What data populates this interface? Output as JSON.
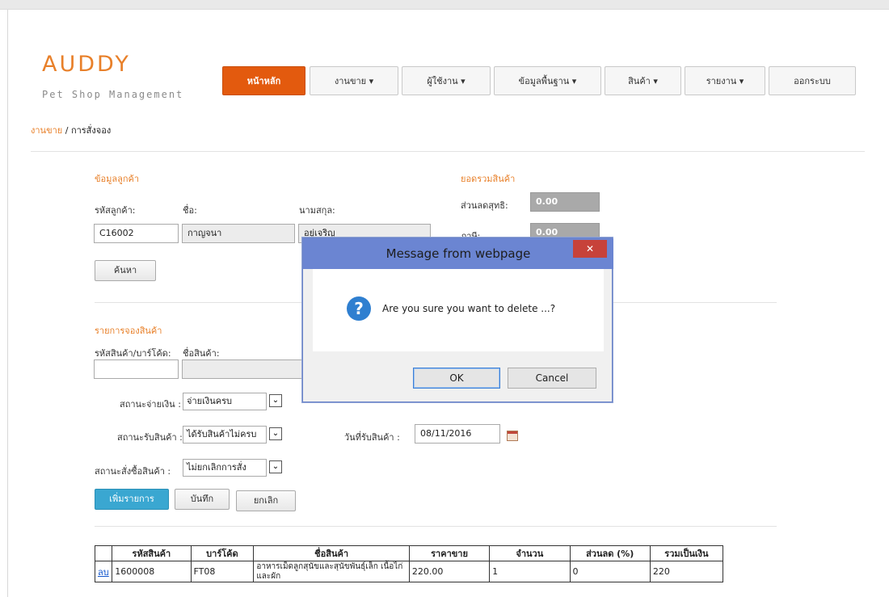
{
  "logo": {
    "title": "AUDDY",
    "tagline": "Pet Shop Management"
  },
  "nav": [
    {
      "label": "หน้าหลัก",
      "active": true
    },
    {
      "label": "งานขาย ▾"
    },
    {
      "label": "ผู้ใช้งาน ▾"
    },
    {
      "label": "ข้อมูลพื้นฐาน ▾"
    },
    {
      "label": "สินค้า ▾"
    },
    {
      "label": "รายงาน ▾"
    },
    {
      "label": "ออกระบบ"
    }
  ],
  "breadcrumb": {
    "parent": "งานขาย",
    "separator": "/",
    "current": "การสั่งจอง"
  },
  "customer": {
    "section_title": "ข้อมูลลูกค้า",
    "code_label": "รหัสลูกค้า:",
    "name_label": "ชื่อ:",
    "surname_label": "นามสกุล:",
    "code_value": "C16002",
    "name_value": "กาญจนา",
    "surname_value": "อยู่เจริญ",
    "search_button": "ค้นหา"
  },
  "summary": {
    "section_title": "ยอดรวมสินค้า",
    "discount_label": "ส่วนลดสุทธิ:",
    "discount_value": "0.00",
    "tax_label": "ภาษี:",
    "tax_value": "0.00"
  },
  "order": {
    "section_title": "รายการจองสินค้า",
    "code_label": "รหัสสินค้า/บาร์โค้ด:",
    "product_label": "ชื่อสินค้า:",
    "payment_label": "สถานะจ่ายเงิน :",
    "payment_value": "จ่ายเงินครบ",
    "receive_label": "สถานะรับสินค้า :",
    "receive_value": "ได้รับสินค้าไม่ครบ",
    "order_status_label": "สถานะสั่งซื้อสินค้า :",
    "order_status_value": "ไม่ยกเลิกการสั่ง",
    "receive_date_label": "วันที่รับสินค้า :",
    "receive_date_value": "08/11/2016",
    "add_button": "เพิ่มรายการ",
    "save_button": "บันทึก",
    "cancel_button": "ยกเลิก"
  },
  "table": {
    "headers": [
      "",
      "รหัสสินค้า",
      "บาร์โค้ด",
      "ชื่อสินค้า",
      "ราคาขาย",
      "จำนวน",
      "ส่วนลด (%)",
      "รวมเป็นเงิน"
    ],
    "rows": [
      {
        "action": "ลบ",
        "code": "1600008",
        "barcode": "FT08",
        "name": "อาหารเม็ดลูกสุนัขและสุนัขพันธุ์เล็ก เนื้อไก่ และผัก",
        "price": "220.00",
        "qty": "1",
        "discount": "0",
        "total": "220"
      }
    ]
  },
  "dialog": {
    "title": "Message from webpage",
    "close_glyph": "✕",
    "icon_glyph": "?",
    "message": "Are you sure you want to delete ...?",
    "ok": "OK",
    "cancel": "Cancel"
  },
  "glyphs": {
    "dropdown": "⌄"
  },
  "colors": {
    "accent": "#e8802a",
    "nav_active": "#e35a0e",
    "primary_button": "#3aa7d1",
    "dialog_title": "#6b85d2",
    "dialog_close": "#c7423a"
  }
}
